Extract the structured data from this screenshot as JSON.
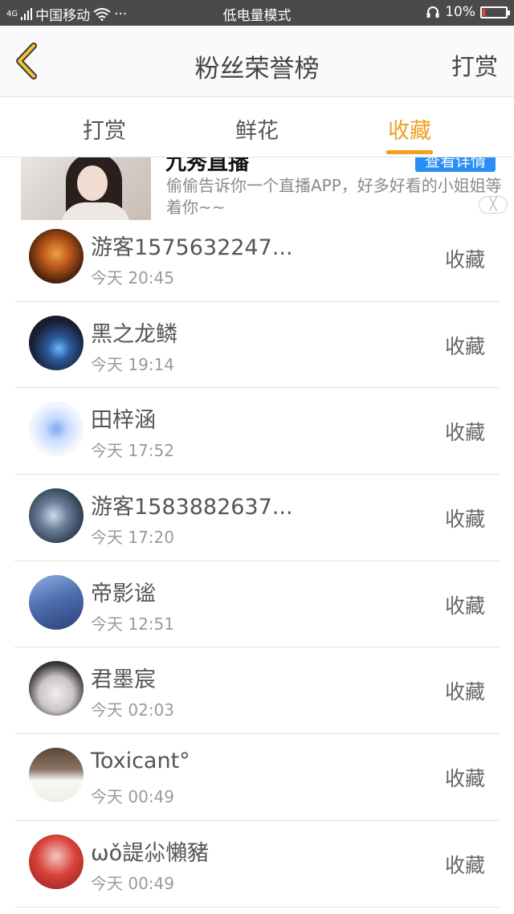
{
  "status_bar": {
    "signal": "4G",
    "carrier": "中国移动",
    "dots": "···",
    "mode": "低电量模式",
    "battery_percent": "10%",
    "battery_level": 0.1
  },
  "nav": {
    "title": "粉丝荣誉榜",
    "right_action": "打赏"
  },
  "tabs": [
    {
      "label": "打赏",
      "active": false
    },
    {
      "label": "鲜花",
      "active": false
    },
    {
      "label": "收藏",
      "active": true
    }
  ],
  "ad": {
    "title_fragment": "九秀直播",
    "button": "查看详情",
    "description": "偷偷告诉你一个直播APP，好多好看的小姐姐等着你~~",
    "close": "╳"
  },
  "list": [
    {
      "name": "游客1575632247...",
      "time": "今天 20:45",
      "action": "收藏"
    },
    {
      "name": "黑之龙鳞",
      "time": "今天 19:14",
      "action": "收藏"
    },
    {
      "name": "田梓涵",
      "time": "今天 17:52",
      "action": "收藏"
    },
    {
      "name": "游客1583882637...",
      "time": "今天 17:20",
      "action": "收藏"
    },
    {
      "name": "帝影谧",
      "time": "今天 12:51",
      "action": "收藏"
    },
    {
      "name": "君墨宸",
      "time": "今天 02:03",
      "action": "收藏"
    },
    {
      "name": "Toxicant°",
      "time": "今天 00:49",
      "action": "收藏"
    },
    {
      "name": "ωǒ諟尛懶豬",
      "time": "今天 00:49",
      "action": "收藏"
    }
  ],
  "colors": {
    "accent": "#f0a020",
    "back_arrow": "#f2c230",
    "ad_button": "#2b8ef5"
  }
}
